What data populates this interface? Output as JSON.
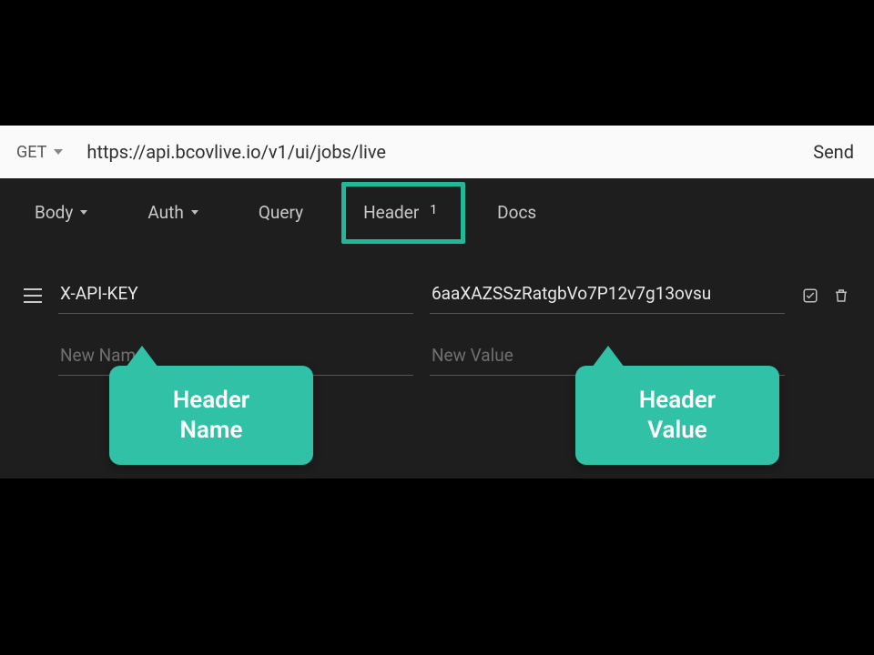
{
  "request": {
    "method": "GET",
    "url": "https://api.bcovlive.io/v1/ui/jobs/live",
    "send_label": "Send"
  },
  "tabs": {
    "body": "Body",
    "auth": "Auth",
    "query": "Query",
    "header": "Header",
    "header_count": "1",
    "docs": "Docs"
  },
  "headers": {
    "row0": {
      "name": "X-API-KEY",
      "value": "6aaXAZSSzRatgbVo7P12v7g13ovsu"
    },
    "placeholders": {
      "name": "New Name",
      "value": "New Value"
    }
  },
  "callouts": {
    "name": "Header\nName",
    "value": "Header\nValue"
  }
}
